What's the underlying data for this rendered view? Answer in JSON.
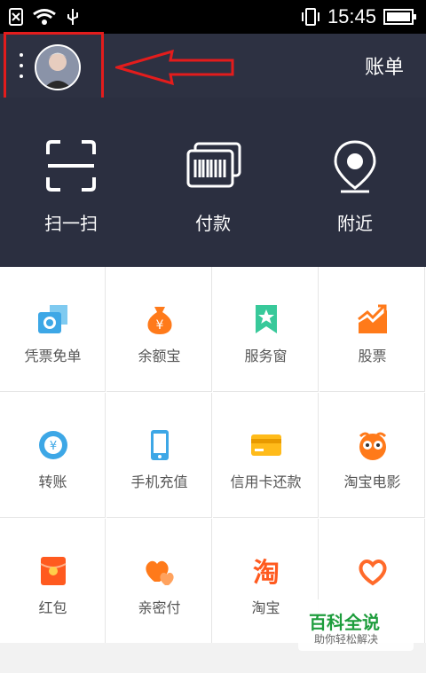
{
  "status_bar": {
    "time": "15:45"
  },
  "header": {
    "bill_label": "账单"
  },
  "quick_actions": [
    {
      "label": "扫一扫",
      "icon": "scan-icon"
    },
    {
      "label": "付款",
      "icon": "barcode-icon"
    },
    {
      "label": "附近",
      "icon": "location-icon"
    }
  ],
  "grid": [
    {
      "label": "凭票免单",
      "icon": "ticket-camera-icon"
    },
    {
      "label": "余额宝",
      "icon": "money-bag-icon"
    },
    {
      "label": "服务窗",
      "icon": "star-bookmark-icon"
    },
    {
      "label": "股票",
      "icon": "stock-chart-icon"
    },
    {
      "label": "转账",
      "icon": "transfer-icon"
    },
    {
      "label": "手机充值",
      "icon": "phone-icon"
    },
    {
      "label": "信用卡还款",
      "icon": "credit-card-icon"
    },
    {
      "label": "淘宝电影",
      "icon": "movie-glasses-icon"
    },
    {
      "label": "红包",
      "icon": "red-packet-icon"
    },
    {
      "label": "亲密付",
      "icon": "hearts-icon"
    },
    {
      "label": "淘宝",
      "icon": "taobao-icon"
    },
    {
      "label": "",
      "icon": "heart-outline-icon"
    }
  ],
  "watermark": {
    "title": "百科全说",
    "subtitle": "助你轻松解决"
  },
  "colors": {
    "header": "#2d3142",
    "accent_red": "#e31c1c",
    "orange": "#ff7a1a",
    "blue": "#3da7e6",
    "green": "#38c99a",
    "watermark_green": "#1e9d3d"
  }
}
